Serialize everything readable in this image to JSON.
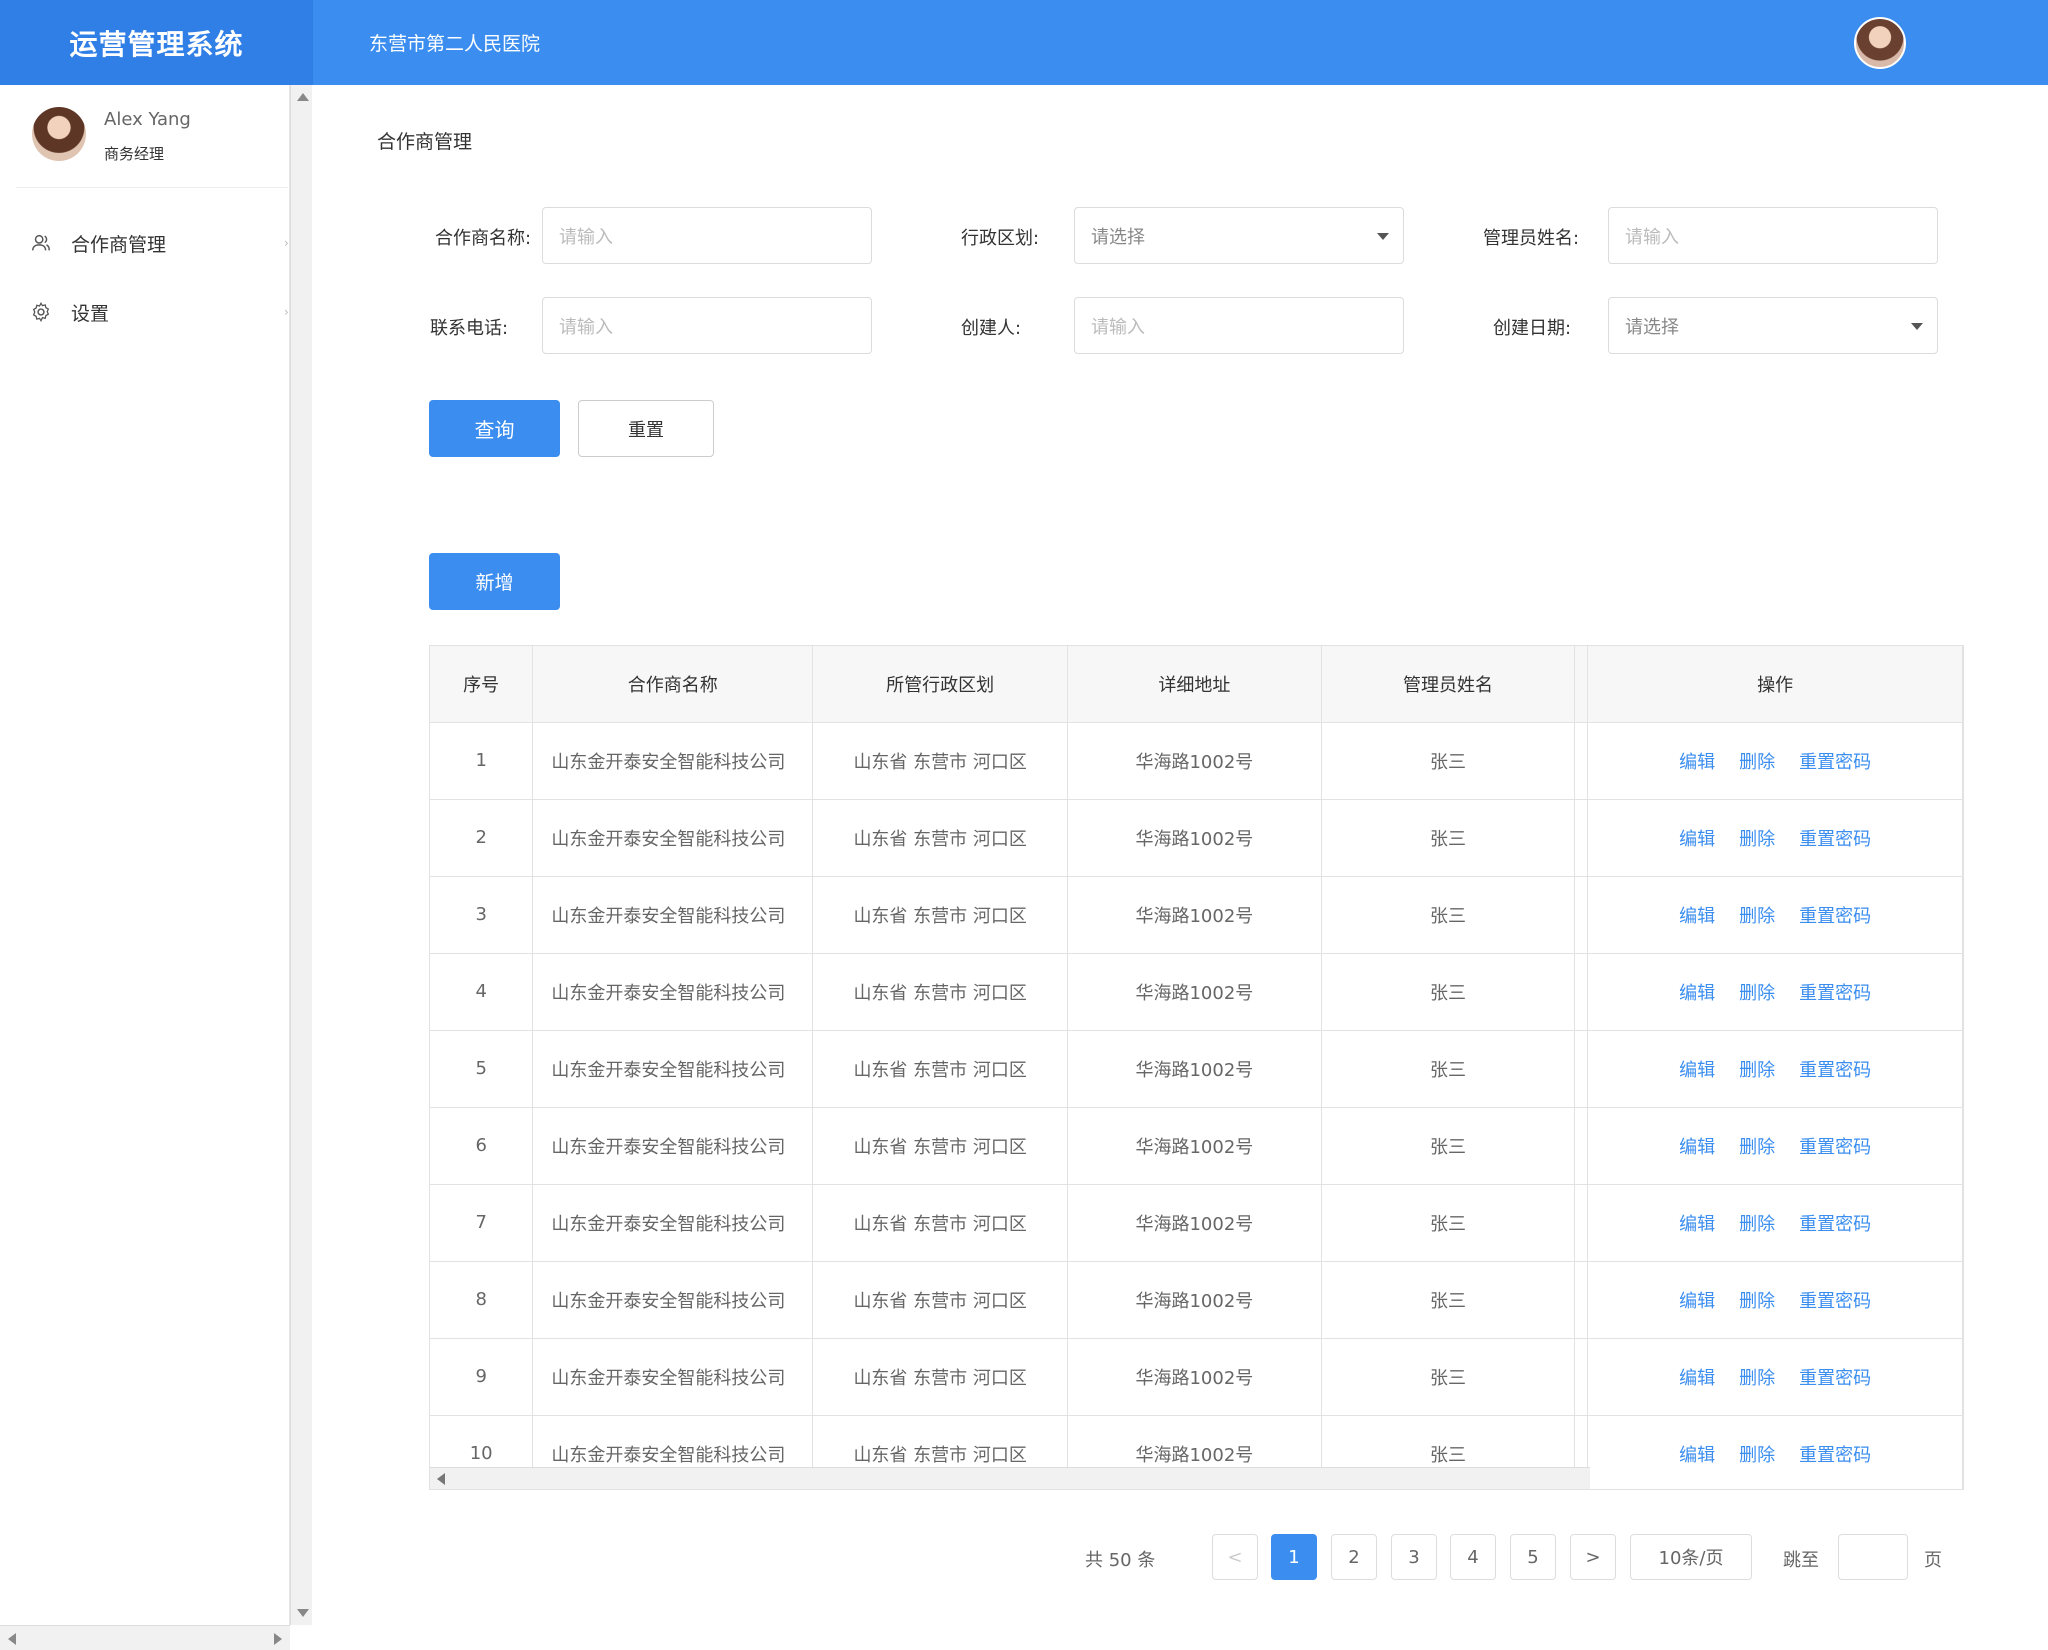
{
  "app": {
    "brand": "运营管理系统",
    "hospital": "东营市第二人民医院"
  },
  "user": {
    "name": "Alex Yang",
    "role": "商务经理"
  },
  "sidebar": {
    "items": [
      {
        "label": "合作商管理",
        "icon": "users-icon"
      },
      {
        "label": "设置",
        "icon": "gear-icon"
      }
    ]
  },
  "page": {
    "title": "合作商管理"
  },
  "filters": {
    "partner_name": {
      "label": "合作商名称:",
      "placeholder": "请输入"
    },
    "region": {
      "label": "行政区划:",
      "placeholder": "请选择"
    },
    "admin_name": {
      "label": "管理员姓名:",
      "placeholder": "请输入"
    },
    "phone": {
      "label": "联系电话:",
      "placeholder": "请输入"
    },
    "creator": {
      "label": "创建人:",
      "placeholder": "请输入"
    },
    "created_date": {
      "label": "创建日期:",
      "placeholder": "请选择"
    }
  },
  "buttons": {
    "query": "查询",
    "reset": "重置",
    "add": "新增"
  },
  "table": {
    "headers": [
      "序号",
      "合作商名称",
      "所管行政区划",
      "详细地址",
      "管理员姓名",
      "操作"
    ],
    "actions": [
      "编辑",
      "删除",
      "重置密码"
    ],
    "rows": [
      [
        "1",
        "山东金开泰安全智能科技公司",
        "山东省 东营市 河口区",
        "华海路1002号",
        "张三"
      ],
      [
        "2",
        "山东金开泰安全智能科技公司",
        "山东省 东营市 河口区",
        "华海路1002号",
        "张三"
      ],
      [
        "3",
        "山东金开泰安全智能科技公司",
        "山东省 东营市 河口区",
        "华海路1002号",
        "张三"
      ],
      [
        "4",
        "山东金开泰安全智能科技公司",
        "山东省 东营市 河口区",
        "华海路1002号",
        "张三"
      ],
      [
        "5",
        "山东金开泰安全智能科技公司",
        "山东省 东营市 河口区",
        "华海路1002号",
        "张三"
      ],
      [
        "6",
        "山东金开泰安全智能科技公司",
        "山东省 东营市 河口区",
        "华海路1002号",
        "张三"
      ],
      [
        "7",
        "山东金开泰安全智能科技公司",
        "山东省 东营市 河口区",
        "华海路1002号",
        "张三"
      ],
      [
        "8",
        "山东金开泰安全智能科技公司",
        "山东省 东营市 河口区",
        "华海路1002号",
        "张三"
      ],
      [
        "9",
        "山东金开泰安全智能科技公司",
        "山东省 东营市 河口区",
        "华海路1002号",
        "张三"
      ],
      [
        "10",
        "山东金开泰安全智能科技公司",
        "山东省 东营市 河口区",
        "华海路1002号",
        "张三"
      ]
    ]
  },
  "pagination": {
    "total_text": "共 50 条",
    "prev": "<",
    "next": ">",
    "pages": [
      "1",
      "2",
      "3",
      "4",
      "5"
    ],
    "current": "1",
    "page_size": "10条/页",
    "jump_label": "跳至",
    "page_label": "页"
  },
  "colors": {
    "primary": "#3b8ef0",
    "brand_bg": "#2f7fe6"
  }
}
